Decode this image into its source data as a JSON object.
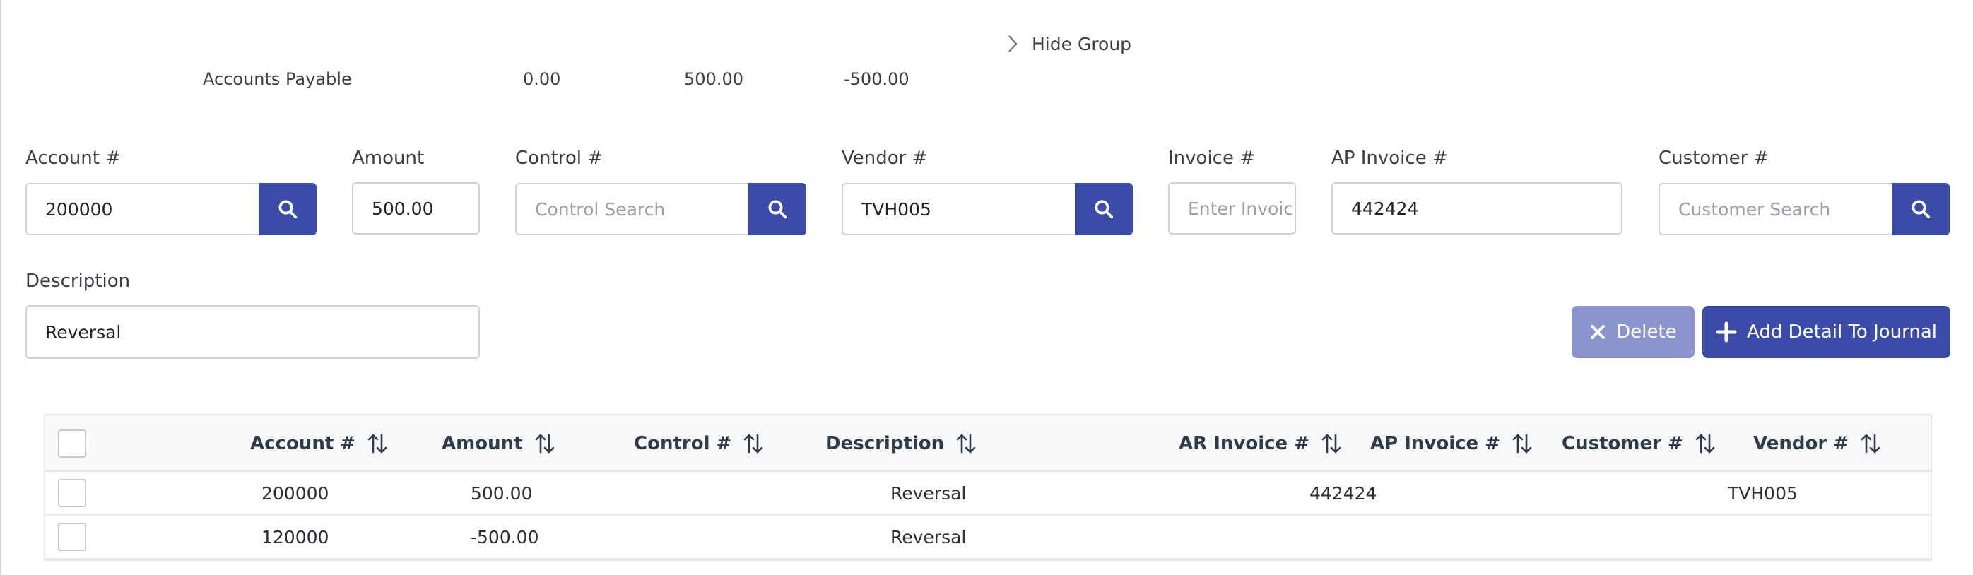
{
  "group": {
    "hide_label": "Hide Group",
    "account_name": "Accounts Payable",
    "debit": "0.00",
    "credit": "500.00",
    "balance": "-500.00"
  },
  "form": {
    "account": {
      "label": "Account #",
      "value": "200000"
    },
    "amount": {
      "label": "Amount",
      "value": "500.00"
    },
    "control": {
      "label": "Control #",
      "placeholder": "Control Search"
    },
    "vendor": {
      "label": "Vendor #",
      "value": "TVH005"
    },
    "invoice": {
      "label": "Invoice #",
      "placeholder": "Enter Invoic"
    },
    "ap_invoice": {
      "label": "AP Invoice #",
      "value": "442424"
    },
    "customer": {
      "label": "Customer #",
      "placeholder": "Customer Search"
    },
    "description": {
      "label": "Description",
      "value": "Reversal"
    }
  },
  "actions": {
    "delete_label": "Delete",
    "add_label": "Add Detail To Journal"
  },
  "table": {
    "columns": [
      "Account #",
      "Amount",
      "Control #",
      "Description",
      "AR Invoice #",
      "AP Invoice #",
      "Customer #",
      "Vendor #"
    ],
    "rows": [
      {
        "account": "200000",
        "amount": "500.00",
        "description": "Reversal",
        "ap_invoice": "442424",
        "vendor": "TVH005"
      },
      {
        "account": "120000",
        "amount": "-500.00",
        "description": "Reversal",
        "ap_invoice": "",
        "vendor": ""
      }
    ]
  },
  "colors": {
    "primary": "#3a4ba8",
    "primary_disabled": "#8b94cf"
  }
}
